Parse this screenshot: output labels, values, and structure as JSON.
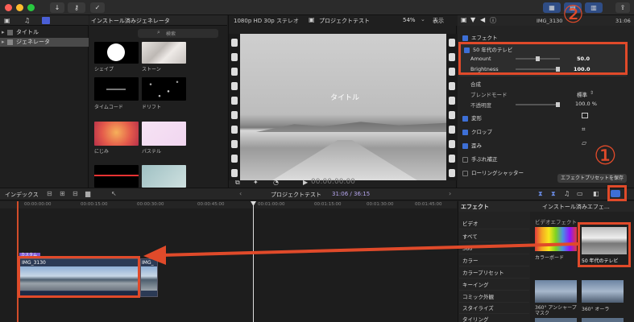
{
  "toolbar": {
    "colors": {
      "close": "#fe5f57",
      "min": "#febc2e",
      "max": "#28c840",
      "accent": "#3d6fd6",
      "highlight": "#e04a2a"
    },
    "left_icons": [
      "down-arrow-icon",
      "key-icon",
      "check-circle-icon"
    ],
    "right_icons": [
      "library-layout-icon",
      "inspector-layout-icon",
      "timeline-layout-icon",
      "share-icon"
    ]
  },
  "library": {
    "items": [
      {
        "label": "タイトル"
      },
      {
        "label": "ジェネレータ"
      }
    ]
  },
  "browser": {
    "title": "インストール済みジェネレータ",
    "search_placeholder": "検索",
    "thumbs": [
      {
        "label": "シェイプ"
      },
      {
        "label": "ストーン"
      },
      {
        "label": "タイムコード"
      },
      {
        "label": "ドリフト"
      },
      {
        "label": "にじみ"
      },
      {
        "label": "パステル"
      }
    ]
  },
  "viewer": {
    "format": "1080p HD 30p ステレオ",
    "project": "プロジェクトテスト",
    "zoom": "54%",
    "view_menu": "表示",
    "overlay_title": "タイトル",
    "timecode": "00:00:00:00"
  },
  "inspector": {
    "clip_name": "IMG_3130",
    "duration": "31:06",
    "effects_header": "エフェクト",
    "effect_name": "50 年代のテレビ",
    "amount_label": "Amount",
    "amount_value": "50.0",
    "brightness_label": "Brightness",
    "brightness_value": "100.0",
    "composite_header": "合成",
    "blend_label": "ブレンドモード",
    "blend_value": "標準",
    "opacity_label": "不透明度",
    "opacity_value": "100.0",
    "opacity_unit": "%",
    "sections": [
      {
        "label": "変形",
        "checked": true
      },
      {
        "label": "クロップ",
        "checked": true
      },
      {
        "label": "歪み",
        "checked": true
      },
      {
        "label": "手ぶれ補正",
        "checked": false
      },
      {
        "label": "ローリングシャッター",
        "checked": false
      }
    ],
    "save_preset": "エフェクトプリセットを保存"
  },
  "timeline_bar": {
    "index": "インデックス",
    "project": "プロジェクトテスト",
    "position": "31:06",
    "duration": "36:15"
  },
  "ruler": [
    "00:00:00:00",
    "00:00:15:00",
    "00:00:30:00",
    "00:00:45:00",
    "00:01:00:00",
    "00:01:15:00",
    "00:01:30:00",
    "00:01:45:00"
  ],
  "clips": {
    "badge": "カスタム",
    "clip1": "IMG_3130",
    "clip2": "IMG_"
  },
  "effects_browser": {
    "header": "エフェクト",
    "dropdown": "インストール済みエフェ…",
    "section": "ビデオエフェクト",
    "categories": [
      "ビデオ",
      "すべて",
      "360°",
      "カラー",
      "カラープリセット",
      "キーイング",
      "コミック外観",
      "スタイライズ",
      "タイリング"
    ],
    "items": [
      {
        "label": "カラーボード"
      },
      {
        "label": "50 年代のテレビ"
      },
      {
        "label": "360° アンシャープマスク"
      },
      {
        "label": "360° オーラ"
      }
    ]
  },
  "annotations": {
    "one": "①",
    "two": "②"
  }
}
